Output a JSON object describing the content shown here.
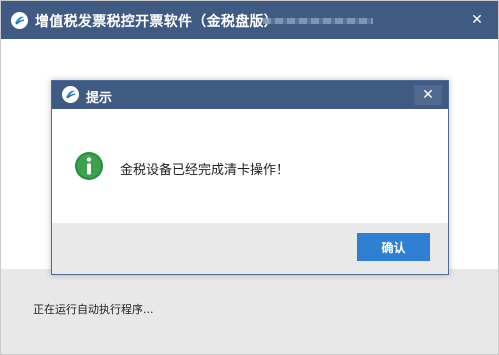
{
  "main_window": {
    "title": "增值税发票税控开票软件（金税盘版）",
    "close_glyph": "✕"
  },
  "status": {
    "text": "正在运行自动执行程序..."
  },
  "dialog": {
    "title": "提示",
    "close_glyph": "✕",
    "message": "金税设备已经完成清卡操作！",
    "ok_label": "确认"
  },
  "colors": {
    "titlebar": "#3f5b84",
    "ok_button": "#2f7fd3",
    "info_icon": "#2c8c3e"
  },
  "icons": {
    "app_logo": "app-logo-icon",
    "info": "info-icon",
    "close": "close-icon"
  }
}
